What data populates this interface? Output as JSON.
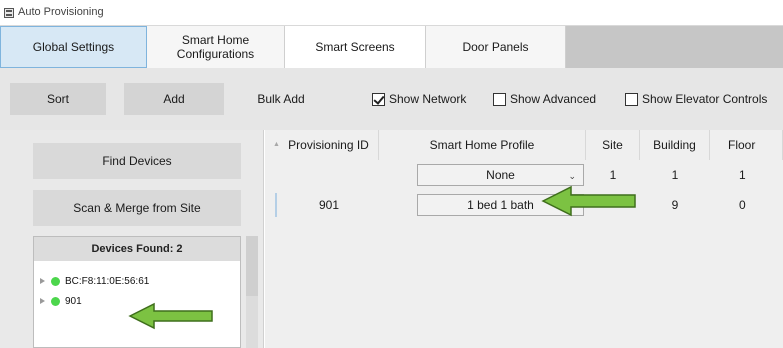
{
  "window": {
    "title": "Auto Provisioning"
  },
  "tabs": [
    {
      "label": "Global Settings"
    },
    {
      "label": "Smart Home\nConfigurations"
    },
    {
      "label": "Smart Screens"
    },
    {
      "label": "Door Panels"
    }
  ],
  "toolbar": {
    "sort_label": "Sort",
    "add_label": "Add",
    "bulk_add_label": "Bulk Add",
    "show_network": {
      "label": "Show Network",
      "checked": true
    },
    "show_advanced": {
      "label": "Show Advanced",
      "checked": false
    },
    "show_elevator": {
      "label": "Show Elevator Controls",
      "checked": false
    }
  },
  "left_panel": {
    "find_devices_label": "Find Devices",
    "scan_merge_label": "Scan & Merge from Site",
    "devices_found_label": "Devices Found: 2",
    "devices": [
      {
        "label": "BC:F8:11:0E:56:61",
        "status_color": "#4cd64c"
      },
      {
        "label": "901",
        "status_color": "#4cd64c"
      }
    ]
  },
  "grid": {
    "columns": [
      "Provisioning ID",
      "Smart Home Profile",
      "Site",
      "Building",
      "Floor"
    ],
    "rows": [
      {
        "provisioning_id": "",
        "profile": "None",
        "site": "1",
        "building": "1",
        "floor": "1"
      },
      {
        "provisioning_id": "901",
        "profile": "1 bed 1 bath",
        "site": "",
        "building": "9",
        "floor": "0"
      }
    ]
  },
  "colors": {
    "active_tab": "#d7e8f5",
    "toolbar_bg": "#e6e6e6",
    "annotation_arrow": "#7cc242",
    "status_online": "#4cd64c"
  }
}
